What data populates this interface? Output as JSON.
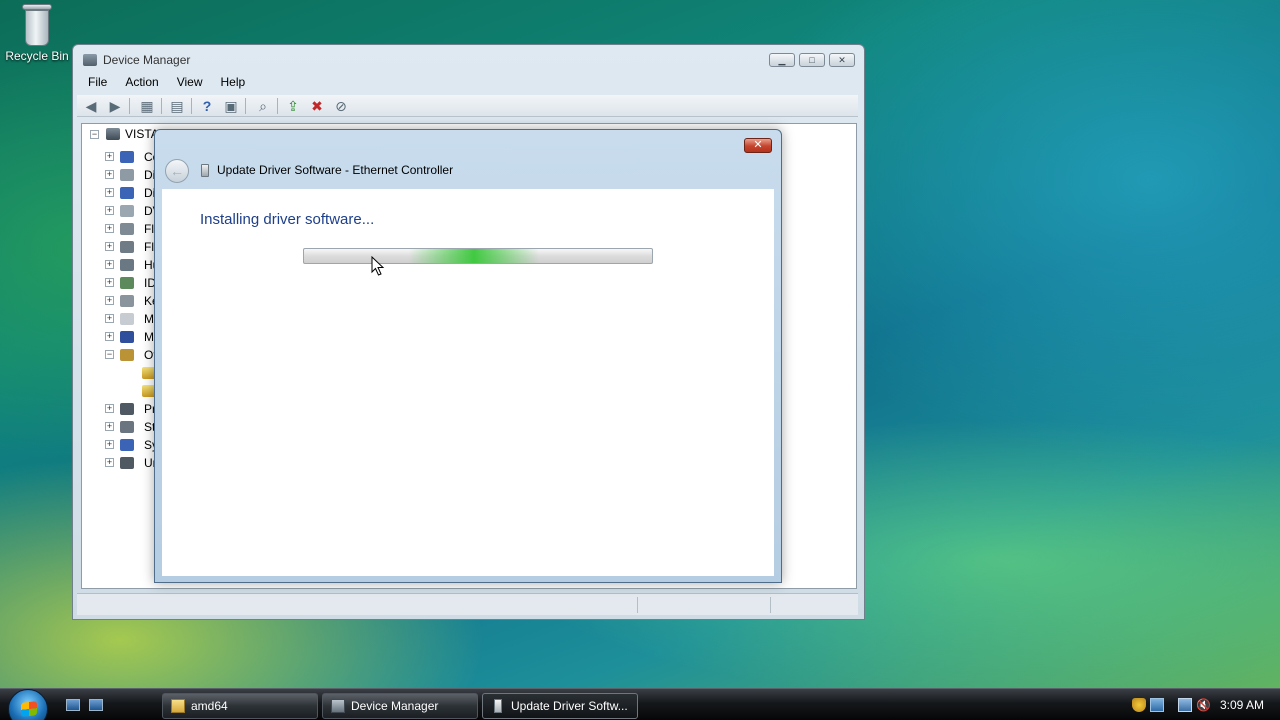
{
  "desktop": {
    "icons": [
      {
        "label": "Recycle Bin",
        "icon": "recycle-bin-icon"
      }
    ]
  },
  "device_manager": {
    "title": "Device Manager",
    "menu": [
      "File",
      "Action",
      "View",
      "Help"
    ],
    "toolbar_icons": [
      "back-arrow-icon",
      "forward-arrow-icon",
      "show-hide-tree-icon",
      "properties-icon",
      "help-icon",
      "view-icon",
      "scan-hardware-icon",
      "update-driver-icon",
      "uninstall-icon",
      "disable-icon"
    ],
    "tree": {
      "root": "VISTA",
      "items": [
        {
          "label": "Co",
          "expander": "+"
        },
        {
          "label": "Di",
          "expander": "+"
        },
        {
          "label": "Di",
          "expander": "+"
        },
        {
          "label": "DV",
          "expander": "+"
        },
        {
          "label": "Fl",
          "expander": "+"
        },
        {
          "label": "Fl",
          "expander": "+"
        },
        {
          "label": "Hu",
          "expander": "+"
        },
        {
          "label": "ID",
          "expander": "+"
        },
        {
          "label": "Ke",
          "expander": "+"
        },
        {
          "label": "M",
          "expander": "+"
        },
        {
          "label": "M",
          "expander": "+"
        },
        {
          "label": "Ot",
          "expander": "-"
        },
        {
          "label": "Pr",
          "expander": "+"
        },
        {
          "label": "St",
          "expander": "+"
        },
        {
          "label": "Sy",
          "expander": "+"
        },
        {
          "label": "Ur",
          "expander": "+"
        }
      ]
    }
  },
  "update_dialog": {
    "title": "Update Driver Software - Ethernet Controller",
    "heading": "Installing driver software...",
    "close_label": "✕"
  },
  "taskbar": {
    "buttons": [
      {
        "label": "amd64",
        "icon": "folder-icon"
      },
      {
        "label": "Device Manager",
        "icon": "device-manager-icon"
      },
      {
        "label": "Update Driver Softw...",
        "icon": "ethernet-icon",
        "active": true
      }
    ],
    "clock": "3:09 AM"
  }
}
